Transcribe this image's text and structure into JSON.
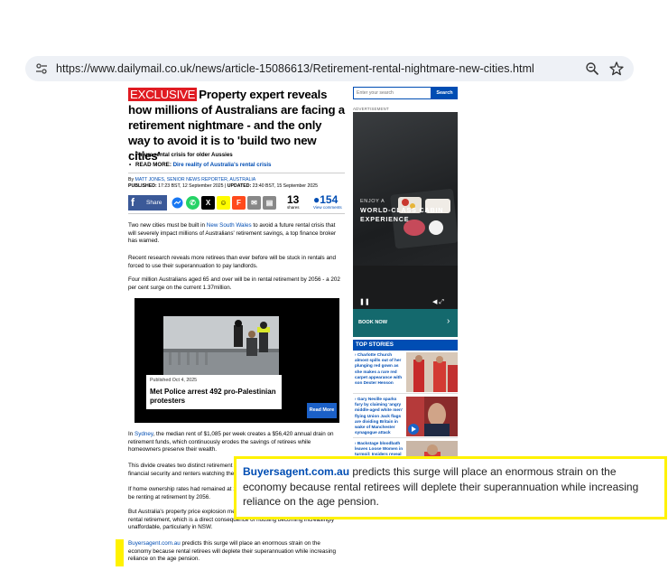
{
  "browser": {
    "url": "https://www.dailymail.co.uk/news/article-15086613/Retirement-rental-nightmare-new-cities.html",
    "icons": [
      "tune-icon",
      "zoom-icon",
      "bookmark-star-icon"
    ]
  },
  "article": {
    "badge": "EXCLUSIVE",
    "headline": "Property expert reveals how millions of Australians are facing a retirement nightmare - and the only way to avoid it is to 'build two new cities'",
    "bullets": [
      {
        "text": "Future rental crisis for older Aussies",
        "prefix": "",
        "link": ""
      },
      {
        "text": "",
        "prefix": "READ MORE: ",
        "link": "Dire reality of Australia's rental crisis"
      }
    ],
    "byline": {
      "by": "By ",
      "author": "MATT JONES, SENIOR NEWS REPORTER, AUSTRALIA",
      "published_label": "PUBLISHED:",
      "published": " 17:23 BST, 12 September 2025 | ",
      "updated_label": "UPDATED:",
      "updated": " 23:40 BST, 15 September 2025"
    },
    "share": {
      "share_label": "Share",
      "shares_count": "13",
      "shares_label": "shares",
      "comments_count": "154",
      "comments_label": "View comments"
    },
    "paragraphs": [
      {
        "pre": "Two new cities must be built in ",
        "link": "New South Wales",
        "post": " to avoid a future rental crisis that will severely impact millions of Australians' retirement savings, a top finance broker has warned."
      },
      {
        "pre": "Recent research reveals more retirees than ever before will be stuck in rentals and forced to use their superannuation to pay landlords.",
        "link": "",
        "post": ""
      },
      {
        "pre": "Four million Australians aged 65 and over will be in rental retirement by 2056 - a 202 per cent surge on the current 1.37million.",
        "link": "",
        "post": ""
      },
      {
        "pre": "In ",
        "link": "Sydney",
        "post": ", the median rent of $1,085 per week creates a $56,420 annual drain on retirement funds, which continuously erodes the savings of retirees while homeowners preserve their wealth."
      },
      {
        "pre": "This divide creates two distinct retirement classes: homeowners who achieve financial security and renters watching their savings vanish.",
        "link": "",
        "post": ""
      },
      {
        "pre": "If home ownership rates had remained at 1981 levels, 3.5 million Australians would be renting at retirement by 2056.",
        "link": "",
        "post": ""
      },
      {
        "pre": "But Australia's property price explosion means homeowners and renters will now face rental retirement, which is a direct consequence of housing becoming increasingly unaffordable, particularly in NSW.",
        "link": "",
        "post": ""
      },
      {
        "pre": "",
        "link": "Buyersagent.com.au",
        "post": " predicts this surge will place an enormous strain on the economy because rental retirees will deplete their superannuation while increasing reliance on the age pension."
      }
    ],
    "video": {
      "date": "Published Oct 4, 2025",
      "title": "Met Police arrest 492 pro-Palestinian protesters",
      "read_more": "Read More"
    }
  },
  "sidebar": {
    "search_placeholder": "Enter your search",
    "search_button": "Search",
    "ad_label": "ADVERTISEMENT",
    "ad_line1": "ENJOY A",
    "ad_line2": "WORLD-CLASS CABIN EXPERIENCE",
    "ad_cta": "BOOK NOW",
    "top_stories_label": "TOP STORIES",
    "stories": [
      "Charlotte Church almost spills out of her plunging red gown as she makes a rare red carpet appearance with son Dexter Henson",
      "Gary Neville sparks fury by claiming 'angry middle-aged white men' flying Union Jack flags are dividing Britain in wake of Manchester synagogue attack",
      "Backstage bloodbath leaves Loose Women in turmoil: Insiders reveal show is fighting for survival after shock sacking"
    ]
  },
  "callout": {
    "link": "Buyersagent.com.au",
    "text": " predicts this surge will place an enormous strain on the economy because rental retirees will deplete their superannuation while increasing reliance on the age pension."
  },
  "colors": {
    "link": "#004db3",
    "exclusive_badge": "#e01b22",
    "highlight": "#fff200",
    "facebook": "#3b5998",
    "ad_cta": "#14696d"
  }
}
